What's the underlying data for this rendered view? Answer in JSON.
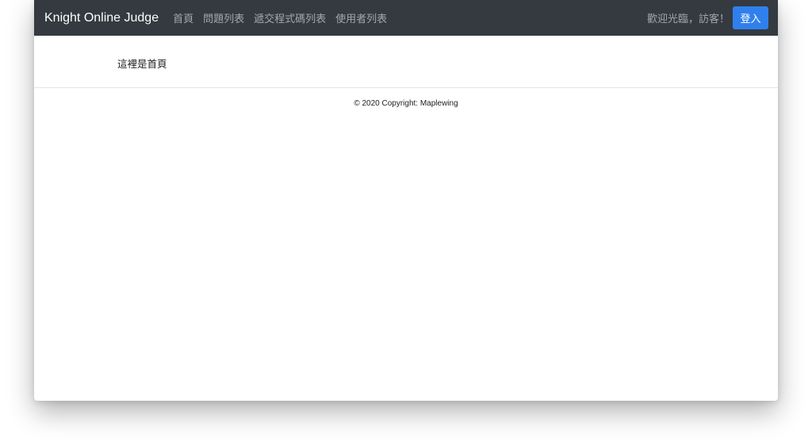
{
  "navbar": {
    "brand": "Knight Online Judge",
    "links": [
      "首頁",
      "問題列表",
      "遞交程式碼列表",
      "使用者列表"
    ],
    "welcome_text": "歡迎光臨，訪客！",
    "login_label": "登入"
  },
  "main": {
    "text": "這裡是首頁"
  },
  "footer": {
    "copyright": "© 2020 Copyright: Maplewing"
  }
}
